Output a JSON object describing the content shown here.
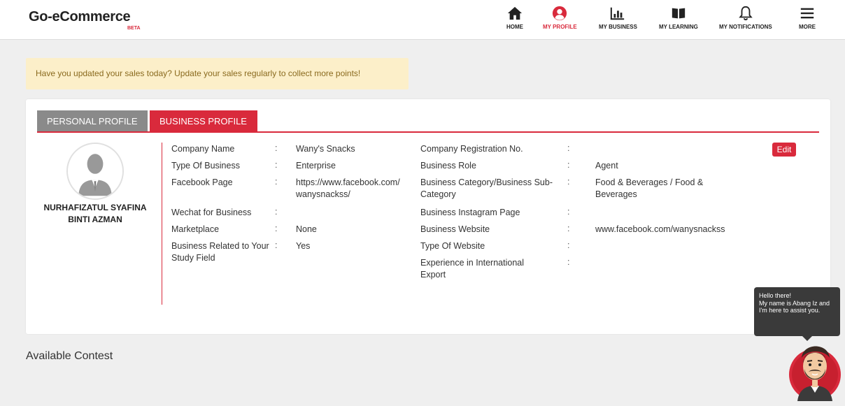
{
  "header": {
    "logo": "Go-eCommerce",
    "beta": "BETA",
    "nav": [
      {
        "label": "HOME",
        "icon": "home-icon"
      },
      {
        "label": "MY PROFILE",
        "icon": "user-circle-icon",
        "active": true
      },
      {
        "label": "MY BUSINESS",
        "icon": "bar-chart-icon"
      },
      {
        "label": "MY LEARNING",
        "icon": "book-open-icon"
      },
      {
        "label": "MY NOTIFICATIONS",
        "icon": "bell-icon"
      },
      {
        "label": "MORE",
        "icon": "menu-icon"
      }
    ]
  },
  "alert": {
    "text": "Have you updated your sales today? Update your sales regularly to collect more points!"
  },
  "tabs": {
    "personal": "PERSONAL PROFILE",
    "business": "BUSINESS PROFILE"
  },
  "profile": {
    "name": "NURHAFIZATUL SYAFINA BINTI AZMAN",
    "edit_label": "Edit",
    "left_fields": [
      {
        "label": "Company Name",
        "value": "Wany's Snacks"
      },
      {
        "label": "Type Of Business",
        "value": "Enterprise"
      },
      {
        "label": "Facebook Page",
        "value": "https://www.facebook.com/wanysnackss/"
      },
      {
        "label": "Wechat for Business",
        "value": ""
      },
      {
        "label": "Marketplace",
        "value": "None"
      },
      {
        "label": "Business Related to Your Study Field",
        "value": "Yes"
      }
    ],
    "right_fields": [
      {
        "label": "Company Registration No.",
        "value": ""
      },
      {
        "label": "Business Role",
        "value": "Agent"
      },
      {
        "label": "Business Category/Business Sub-Category",
        "value": "Food & Beverages / Food & Beverages"
      },
      {
        "label": "Business Instagram Page",
        "value": ""
      },
      {
        "label": "Business Website",
        "value": "www.facebook.com/wanysnackss"
      },
      {
        "label": "Type Of Website",
        "value": ""
      },
      {
        "label": "Experience in International Export",
        "value": ""
      }
    ],
    "colon": ":"
  },
  "contest": {
    "title": "Available Contest"
  },
  "chatbot": {
    "line1": "Hello there!",
    "line2": "My name is Abang Iz and I'm here to assist you."
  },
  "colors": {
    "accent": "#d92a3c",
    "tab_inactive": "#8a8a8a",
    "alert_bg": "#fcefc9"
  }
}
